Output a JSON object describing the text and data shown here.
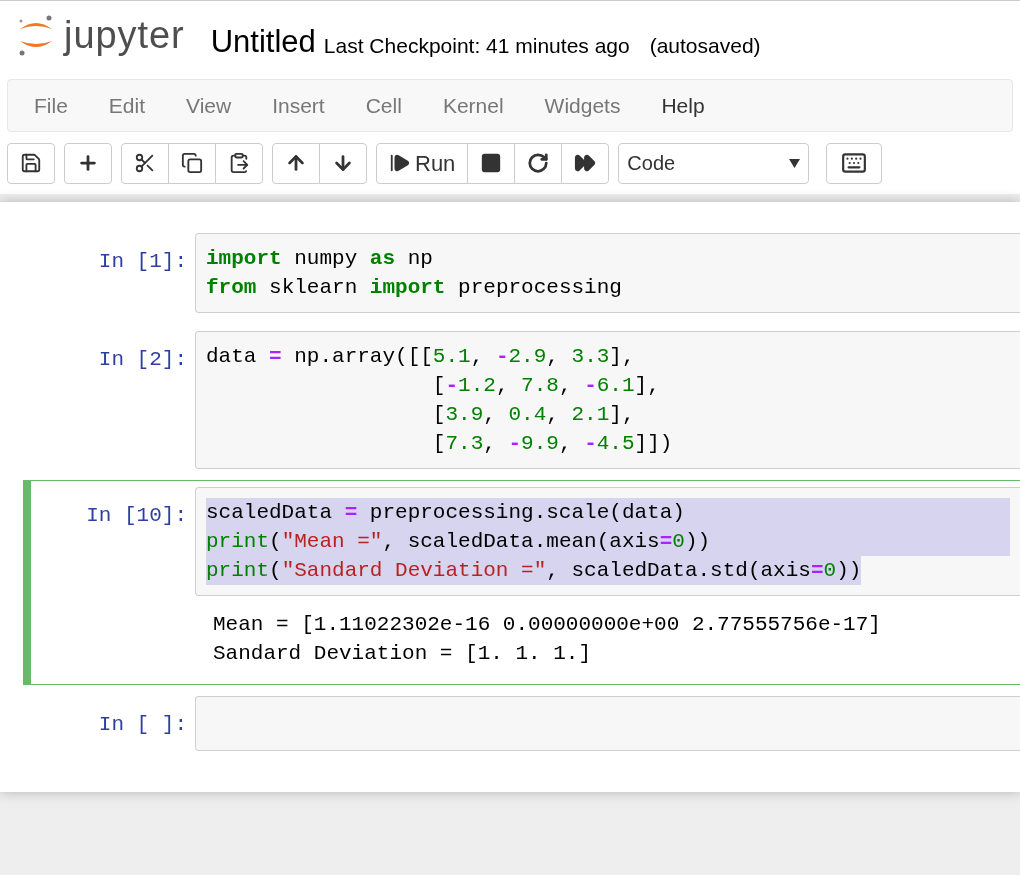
{
  "header": {
    "logo_text": "jupyter",
    "title": "Untitled",
    "checkpoint": "Last Checkpoint: 41 minutes ago",
    "autosave": "(autosaved)"
  },
  "menu": [
    {
      "label": "File",
      "selected": false
    },
    {
      "label": "Edit",
      "selected": false
    },
    {
      "label": "View",
      "selected": false
    },
    {
      "label": "Insert",
      "selected": false
    },
    {
      "label": "Cell",
      "selected": false
    },
    {
      "label": "Kernel",
      "selected": false
    },
    {
      "label": "Widgets",
      "selected": false
    },
    {
      "label": "Help",
      "selected": true
    }
  ],
  "toolbar": {
    "groups": [
      [
        {
          "kind": "save"
        }
      ],
      [
        {
          "kind": "add"
        }
      ],
      [
        {
          "kind": "cut"
        },
        {
          "kind": "copy"
        },
        {
          "kind": "paste"
        }
      ],
      [
        {
          "kind": "up"
        },
        {
          "kind": "down"
        }
      ],
      [
        {
          "kind": "run",
          "label": "Run"
        },
        {
          "kind": "stop"
        },
        {
          "kind": "restart"
        },
        {
          "kind": "run-all"
        }
      ]
    ],
    "cell_type": "Code"
  },
  "cells": [
    {
      "prompt": "In [1]:",
      "selected": false,
      "lines": [
        {
          "highlighted": false,
          "tokens": [
            {
              "kind": "keyword",
              "text": "import"
            },
            {
              "kind": "plain",
              "text": " numpy "
            },
            {
              "kind": "keyword",
              "text": "as"
            },
            {
              "kind": "plain",
              "text": " np"
            }
          ]
        },
        {
          "highlighted": false,
          "tokens": [
            {
              "kind": "keyword",
              "text": "from"
            },
            {
              "kind": "plain",
              "text": " sklearn "
            },
            {
              "kind": "keyword",
              "text": "import"
            },
            {
              "kind": "plain",
              "text": " preprocessing"
            }
          ]
        }
      ]
    },
    {
      "prompt": "In [2]:",
      "selected": false,
      "lines": [
        {
          "highlighted": false,
          "tokens": [
            {
              "kind": "plain",
              "text": "data "
            },
            {
              "kind": "operator",
              "text": "="
            },
            {
              "kind": "plain",
              "text": " np.array([["
            },
            {
              "kind": "number",
              "text": "5.1"
            },
            {
              "kind": "plain",
              "text": ", "
            },
            {
              "kind": "operator",
              "text": "-"
            },
            {
              "kind": "number",
              "text": "2.9"
            },
            {
              "kind": "plain",
              "text": ", "
            },
            {
              "kind": "number",
              "text": "3.3"
            },
            {
              "kind": "plain",
              "text": "],"
            }
          ]
        },
        {
          "highlighted": false,
          "tokens": [
            {
              "kind": "plain",
              "text": "                  ["
            },
            {
              "kind": "operator",
              "text": "-"
            },
            {
              "kind": "number",
              "text": "1.2"
            },
            {
              "kind": "plain",
              "text": ", "
            },
            {
              "kind": "number",
              "text": "7.8"
            },
            {
              "kind": "plain",
              "text": ", "
            },
            {
              "kind": "operator",
              "text": "-"
            },
            {
              "kind": "number",
              "text": "6.1"
            },
            {
              "kind": "plain",
              "text": "],"
            }
          ]
        },
        {
          "highlighted": false,
          "tokens": [
            {
              "kind": "plain",
              "text": "                  ["
            },
            {
              "kind": "number",
              "text": "3.9"
            },
            {
              "kind": "plain",
              "text": ", "
            },
            {
              "kind": "number",
              "text": "0.4"
            },
            {
              "kind": "plain",
              "text": ", "
            },
            {
              "kind": "number",
              "text": "2.1"
            },
            {
              "kind": "plain",
              "text": "],"
            }
          ]
        },
        {
          "highlighted": false,
          "tokens": [
            {
              "kind": "plain",
              "text": "                  ["
            },
            {
              "kind": "number",
              "text": "7.3"
            },
            {
              "kind": "plain",
              "text": ", "
            },
            {
              "kind": "operator",
              "text": "-"
            },
            {
              "kind": "number",
              "text": "9.9"
            },
            {
              "kind": "plain",
              "text": ", "
            },
            {
              "kind": "operator",
              "text": "-"
            },
            {
              "kind": "number",
              "text": "4.5"
            },
            {
              "kind": "plain",
              "text": "]])"
            }
          ]
        }
      ]
    },
    {
      "prompt": "In [10]:",
      "selected": true,
      "lines": [
        {
          "highlighted": true,
          "tokens": [
            {
              "kind": "plain",
              "text": "scaledData "
            },
            {
              "kind": "operator",
              "text": "="
            },
            {
              "kind": "plain",
              "text": " preprocessing.scale(data)"
            }
          ]
        },
        {
          "highlighted": true,
          "tokens": [
            {
              "kind": "builtin",
              "text": "print"
            },
            {
              "kind": "plain",
              "text": "("
            },
            {
              "kind": "string",
              "text": "\"Mean =\""
            },
            {
              "kind": "plain",
              "text": ", scaledData.mean(axis"
            },
            {
              "kind": "operator",
              "text": "="
            },
            {
              "kind": "number",
              "text": "0"
            },
            {
              "kind": "plain",
              "text": "))"
            }
          ]
        },
        {
          "highlighted": true,
          "tokens": [
            {
              "kind": "builtin",
              "text": "print"
            },
            {
              "kind": "plain",
              "text": "("
            },
            {
              "kind": "string",
              "text": "\"Sandard Deviation =\""
            },
            {
              "kind": "plain",
              "text": ", scaledData.std(axis"
            },
            {
              "kind": "operator",
              "text": "="
            },
            {
              "kind": "number",
              "text": "0"
            },
            {
              "kind": "plain",
              "text": "))"
            }
          ]
        }
      ],
      "output": [
        "Mean = [1.11022302e-16 0.00000000e+00 2.77555756e-17]",
        "Sandard Deviation = [1. 1. 1.]"
      ]
    },
    {
      "prompt": "In [ ]:",
      "selected": false
    }
  ]
}
